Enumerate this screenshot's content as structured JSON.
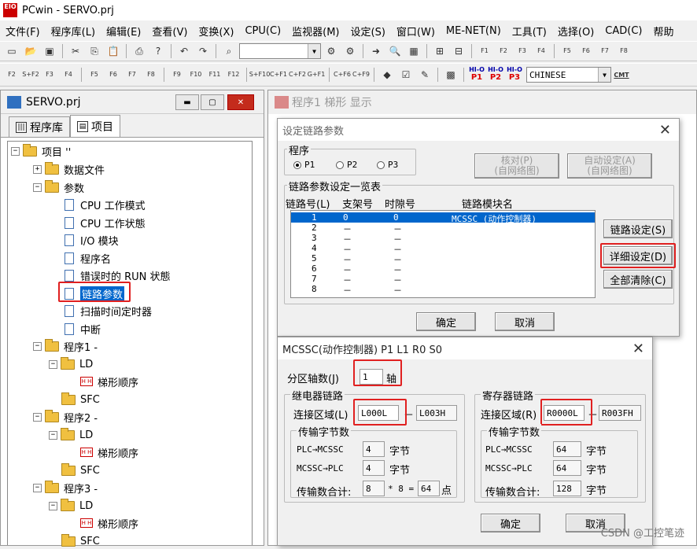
{
  "window": {
    "title": "PCwin - SERVO.prj",
    "app_icon": "pcwin-app-icon"
  },
  "menu": [
    "文件(F)",
    "程序库(L)",
    "编辑(E)",
    "查看(V)",
    "变换(X)",
    "CPU(C)",
    "监视器(M)",
    "设定(S)",
    "窗口(W)",
    "ME-NET(N)",
    "工具(T)",
    "选择(O)",
    "CAD(C)",
    "帮助"
  ],
  "toolbar2": {
    "language": "CHINESE",
    "p1": "P1",
    "p2": "P2",
    "p3": "P3",
    "hi": "HI-O",
    "cmt": "CMT"
  },
  "fkeys_top": [
    "F1",
    "F2",
    "F3",
    "F4",
    "F5",
    "F6",
    "F7",
    "F8"
  ],
  "fkeys_bottom": [
    "F2",
    "S+F2",
    "F3",
    "F4",
    "F5",
    "F6",
    "F7",
    "F8",
    "F9",
    "F10",
    "F11",
    "F12",
    "S+F10",
    "C+F1",
    "C+F2",
    "G+F1",
    "C+F6",
    "C+F9"
  ],
  "project": {
    "title": "SERVO.prj",
    "tabs": [
      "程序库",
      "项目"
    ],
    "tree": {
      "root": "项目 ''",
      "data_files": "数据文件",
      "params": "参数",
      "cpu_mode": "CPU 工作模式",
      "cpu_state": "CPU 工作状態",
      "io_module": "I/O 模块",
      "prog_name": "程序名",
      "err_run": "错误时的 RUN 状態",
      "link_params": "链路参数",
      "scan_timer": "扫描时间定时器",
      "interrupt": "中断",
      "prog1": "程序1 -",
      "prog2": "程序2 -",
      "prog3": "程序3 -",
      "ld": "LD",
      "ladder": "梯形顺序",
      "sfc": "SFC"
    }
  },
  "mdi": {
    "title": "程序1 梯形 显示"
  },
  "link_dialog": {
    "title": "设定链路参数",
    "program_group": "程序",
    "programs": [
      "P1",
      "P2",
      "P3"
    ],
    "selected_program": "P1",
    "verify_btn": [
      "核对(P)",
      "(自网络图)"
    ],
    "auto_btn": [
      "自动设定(A)",
      "(自网络图)"
    ],
    "list_group": "链路参数设定一览表",
    "headers": [
      "链路号(L)",
      "支架号",
      "时隙号",
      "链路模块名"
    ],
    "rows": [
      [
        "1",
        "0",
        "0",
        "MCSSC (动作控制器)"
      ],
      [
        "2",
        "－",
        "－",
        ""
      ],
      [
        "3",
        "－",
        "－",
        ""
      ],
      [
        "4",
        "－",
        "－",
        ""
      ],
      [
        "5",
        "－",
        "－",
        ""
      ],
      [
        "6",
        "－",
        "－",
        ""
      ],
      [
        "7",
        "－",
        "－",
        ""
      ],
      [
        "8",
        "－",
        "－",
        ""
      ]
    ],
    "link_set_btn": "链路设定(S)",
    "detail_btn": "详细设定(D)",
    "clear_btn": "全部清除(C)",
    "ok": "确定",
    "cancel": "取消"
  },
  "mcssc_dialog": {
    "title": "MCSSC(动作控制器)  P1 L1 R0 S0",
    "axes_label": "分区轴数(J)",
    "axes_value": "1",
    "axes_unit": "轴",
    "relay_group": "继电器链路",
    "relay_conn_label": "连接区域(L)",
    "relay_from": "L000L",
    "relay_to": "L003H",
    "relay_bytes_group": "传输字节数",
    "relay_plc_to": "PLC→MCSSC",
    "relay_plc_to_val": "4",
    "relay_to_plc": "MCSSC→PLC",
    "relay_to_plc_val": "4",
    "byte_unit": "字节",
    "total_label": "传输数合计:",
    "total_val": "8",
    "times": "* 8 =",
    "total_points": "64",
    "point_unit": "点",
    "reg_group": "寄存器链路",
    "reg_conn_label": "连接区域(R)",
    "reg_from": "R0000L",
    "reg_to": "R003FH",
    "reg_bytes_group": "传输字节数",
    "reg_plc_to_val": "64",
    "reg_to_plc_val": "64",
    "reg_total_val": "128",
    "dash": "－",
    "ok": "确定",
    "cancel": "取消"
  },
  "watermark": "CSDN @工控笔迹"
}
